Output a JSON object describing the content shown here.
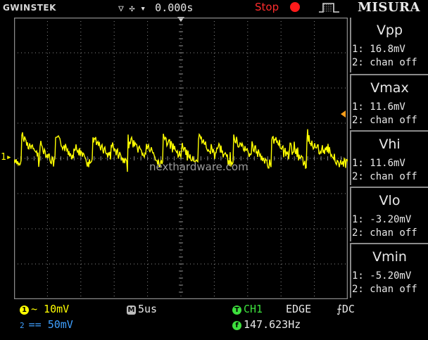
{
  "header": {
    "brand": "GWINSTEK",
    "trigger_glyphs": "▽ ✣ ▾",
    "trigger_delay": "0.000s",
    "run_status": "Stop",
    "menu_title": "MISURA"
  },
  "plot": {
    "channel_marker": "1▸",
    "watermark": "nexthardware.com",
    "grid": true
  },
  "measurements": [
    {
      "name": "Vpp",
      "ch1": "1: 16.8mV",
      "ch2": "2: chan off"
    },
    {
      "name": "Vmax",
      "ch1": "1: 11.6mV",
      "ch2": "2: chan off"
    },
    {
      "name": "Vhi",
      "ch1": "1: 11.6mV",
      "ch2": "2: chan off"
    },
    {
      "name": "Vlo",
      "ch1": "1: -3.20mV",
      "ch2": "2: chan off"
    },
    {
      "name": "Vmin",
      "ch1": "1: -5.20mV",
      "ch2": "2: chan off"
    }
  ],
  "footer": {
    "ch1_badge": "1",
    "ch1_scale": "~ 10mV",
    "ch2_badge": "2",
    "ch2_scale": "== 50mV",
    "timebase_badge": "M",
    "timebase": "5us",
    "trig_badge": "T",
    "trig_source": "CH1",
    "trig_type": "EDGE",
    "trig_coupling": "⨍DC",
    "freq_badge": "f",
    "frequency": "147.623Hz"
  },
  "colors": {
    "ch1": "#ffff00",
    "ch2": "#3fa0ff",
    "stop": "#ff2d2d",
    "trigger": "#3de03d",
    "grid": "#8a8a8a"
  },
  "icons": [
    "stop-indicator-icon",
    "pulse-trigger-icon",
    "trigger-level-marker-icon",
    "trigger-position-marker-icon"
  ]
}
